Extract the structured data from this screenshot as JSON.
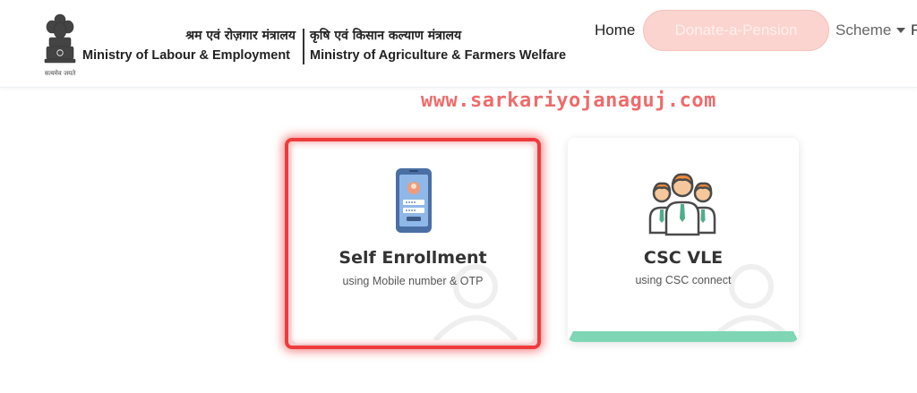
{
  "header": {
    "ministry_left_hindi": "श्रम एवं रोज़गार मंत्रालय",
    "ministry_left_english": "Ministry of Labour & Employment",
    "ministry_right_hindi": "कृषि एवं किसान कल्याण मंत्रालय",
    "ministry_right_english": "Ministry of Agriculture & Farmers Welfare",
    "emblem_icon": "national-emblem-icon"
  },
  "nav": {
    "home": "Home",
    "donate": "Donate-a-Pension",
    "scheme": "Scheme",
    "next_partial": "F"
  },
  "watermark": "www.sarkariyojanaguj.com",
  "cards": [
    {
      "title": "Self Enrollment",
      "subtitle": "using Mobile number & OTP",
      "icon": "mobile-login-icon"
    },
    {
      "title": "CSC VLE",
      "subtitle": "using CSC connect",
      "icon": "group-users-icon"
    }
  ],
  "colors": {
    "highlight": "#ee3b3b",
    "donate_bg": "#fbd4cf",
    "csc_bar": "#7fd6b4",
    "watermark": "#ef6b6b",
    "person_orange": "#f28b3c"
  }
}
